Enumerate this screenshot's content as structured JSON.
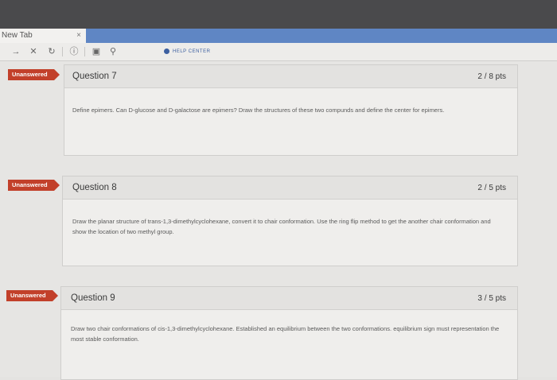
{
  "browser": {
    "tab_title": "New Tab",
    "tab_close": "×",
    "help_center": "HELP CENTER"
  },
  "toolbar_icons": [
    "arrow-right-icon",
    "close-icon",
    "reload-icon",
    "info-icon",
    "page-icon",
    "search-icon"
  ],
  "questions": [
    {
      "status": "Unanswered",
      "title": "Question 7",
      "points": "2 / 8 pts",
      "text": "Define epimers. Can D-glucose and D-galactose are epimers? Draw the structures of these two compunds and define the center for epimers."
    },
    {
      "status": "Unanswered",
      "title": "Question 8",
      "points": "2 / 5 pts",
      "text": "Draw the planar structure of trans-1,3-dimethylcyclohexane, convert it to chair conformation. Use the ring flip method to get the another chair conformation and show the location of two methyl group."
    },
    {
      "status": "Unanswered",
      "title": "Question 9",
      "points": "3 / 5 pts",
      "text": "Draw two chair conformations of cis-1,3-dimethylcyclohexane. Established an equilibrium between the two conformations. equilibrium sign must representation the most stable conformation."
    }
  ],
  "colors": {
    "badge": "#c2402a",
    "address_bar": "#5f86c4",
    "help_center": "#3c5fa0"
  }
}
